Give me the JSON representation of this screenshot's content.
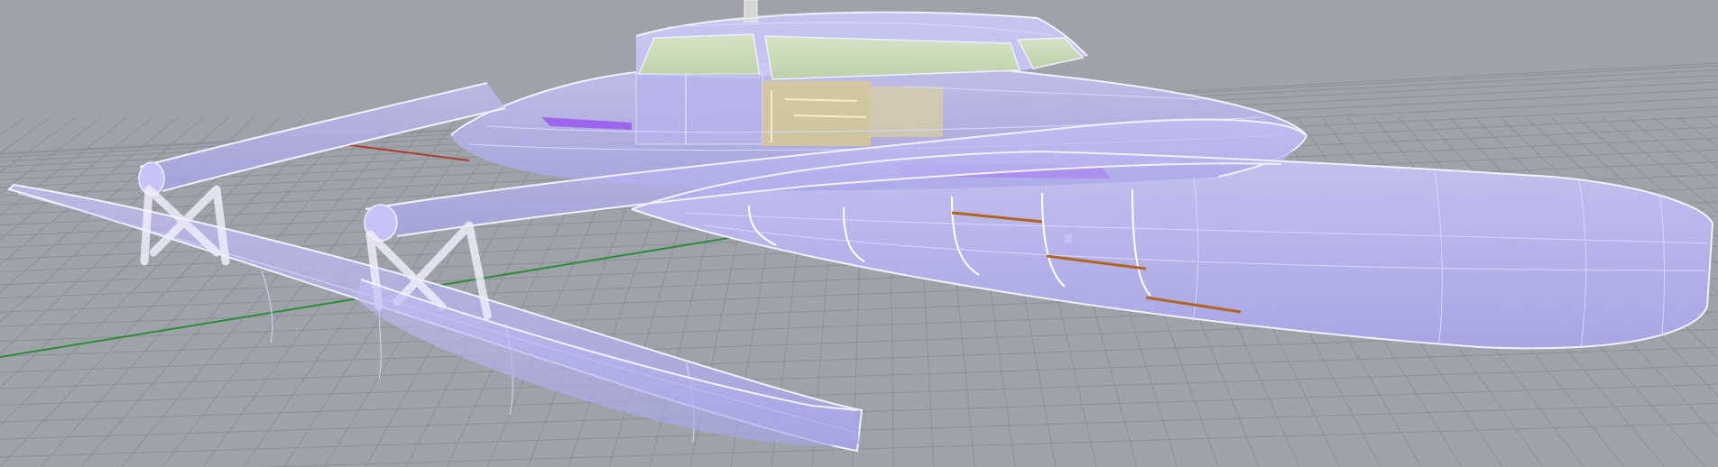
{
  "viewport": {
    "mode": "perspective-shaded-xray",
    "background_color": "#9ea3a9",
    "grid_color": "#8c9197",
    "x_axis_color": "#b03a2e",
    "y_axis_color": "#2e8b3a",
    "surface_fill": "#b9b6f0",
    "surface_edge": "#f2f0ff",
    "isocurve_color": "#d8d6ff",
    "glass_color": "#cfe3b0",
    "interior_yellow": "#e6d890",
    "highlight_purple": "#9b5cf0",
    "floor_edge": "#b0661e"
  },
  "model": {
    "type": "trimaran",
    "components": [
      "main-hull",
      "port-ama",
      "starboard-ama",
      "forward-crossbeam",
      "aft-crossbeam",
      "deckhouse",
      "mast-stub"
    ]
  }
}
